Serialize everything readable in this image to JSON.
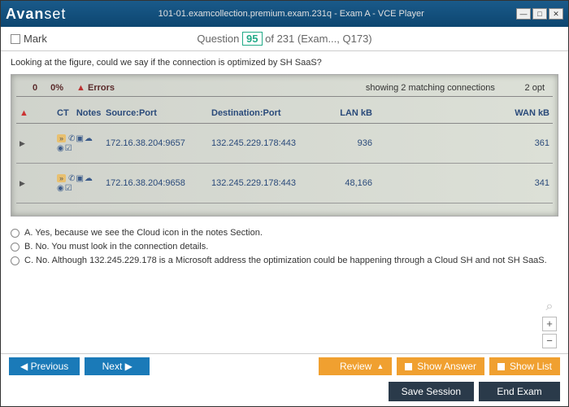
{
  "window": {
    "logo_prefix": "Avan",
    "logo_suffix": "set",
    "title": "101-01.examcollection.premium.exam.231q - Exam A - VCE Player"
  },
  "header": {
    "mark_label": "Mark",
    "question_label": "Question",
    "current": "95",
    "total_suffix": "of 231 (Exam..., Q173)"
  },
  "question": {
    "text": "Looking at the figure, could we say if the connection is optimized by SH SaaS?"
  },
  "figure": {
    "top_left": {
      "percent": "0%",
      "errors": "Errors",
      "zero": "0"
    },
    "top_right_showing": "showing 2 matching connections",
    "top_right_opt": "2 opt",
    "cols": {
      "ct": "CT",
      "notes": "Notes",
      "source": "Source:Port",
      "dest": "Destination:Port",
      "lan": "LAN kB",
      "wan": "WAN kB"
    },
    "rows": [
      {
        "source": "172.16.38.204:9657",
        "dest": "132.245.229.178:443",
        "lan": "936",
        "wan": "361"
      },
      {
        "source": "172.16.38.204:9658",
        "dest": "132.245.229.178:443",
        "lan": "48,166",
        "wan": "341"
      }
    ]
  },
  "answers": {
    "a": "A.   Yes, because we see the Cloud icon in the notes Section.",
    "b": "B.   No. You must look in the connection details.",
    "c": "C.   No. Although 132.245.229.178 is a Microsoft address the optimization could be happening through a Cloud SH and not SH SaaS."
  },
  "footer": {
    "prev": "Previous",
    "next": "Next",
    "review": "Review",
    "show_answer": "Show Answer",
    "show_list": "Show List",
    "save": "Save Session",
    "end": "End Exam"
  }
}
